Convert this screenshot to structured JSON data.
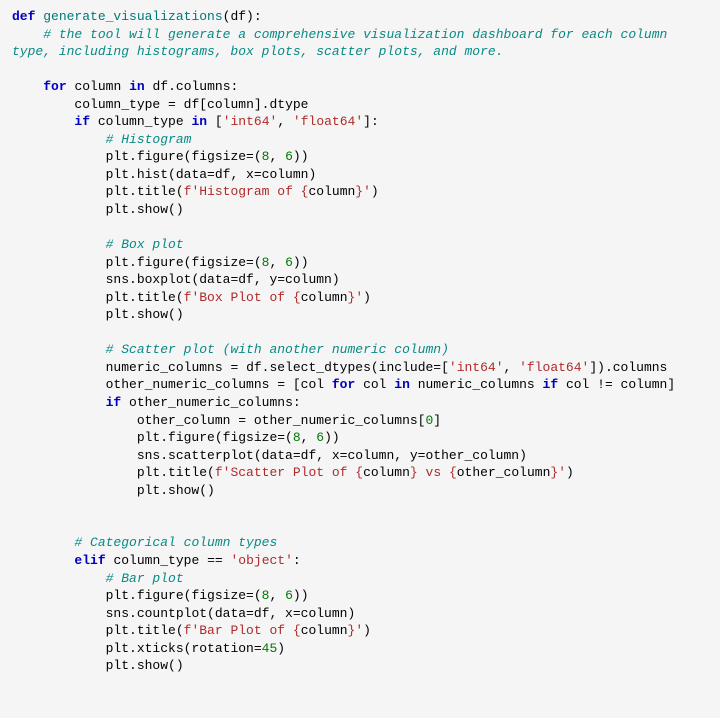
{
  "code": {
    "fn_def": "def",
    "fn_name": "generate_visualizations",
    "fn_args": "(df):",
    "comment_intro": "# the tool will generate a comprehensive visualization dashboard for each column type, including histograms, box plots, scatter plots, and more.",
    "for_kw": "for",
    "in_kw": "in",
    "if_kw": "if",
    "elif_kw": "elif",
    "loop_var": "column",
    "df_columns": "df.columns:",
    "column_type": "column_type",
    "assign": " = ",
    "df_col": "df[column].dtype",
    "type_check": "column_type",
    "int64": "'int64'",
    "float64": "'float64'",
    "object_str": "'object'",
    "hist_comment": "# Histogram",
    "box_comment": "# Box plot",
    "scatter_comment": "# Scatter plot (with another numeric column)",
    "categorical_comment": "# Categorical column types",
    "bar_comment": "# Bar plot",
    "plt_figure": "plt.figure(figsize=(",
    "figsize_w": "8",
    "figsize_h": "6",
    "plt_hist": "plt.hist(data=df, x=column)",
    "plt_title": "plt.title(",
    "plt_show": "plt.show()",
    "plt_xticks": "plt.xticks(rotation=",
    "rotation_val": "45",
    "f_prefix": "f",
    "hist_title_a": "'Histogram of ",
    "box_title_a": "'Box Plot of ",
    "scatter_title_a": "'Scatter Plot of ",
    "scatter_title_b": " vs ",
    "bar_title_a": "'Bar Plot of ",
    "brace_open": "{",
    "brace_close": "}",
    "col_var": "column",
    "other_col_var": "other_column",
    "title_end": "'",
    "sns_box": "sns.boxplot(data=df, y=column)",
    "sns_count": "sns.countplot(data=df, x=column)",
    "sns_scatter": "sns.scatterplot(data=df, x=column, y=other_column)",
    "numeric_cols": "numeric_columns",
    "select_dtypes": "df.select_dtypes(include=[",
    "dot_columns": "]).columns",
    "other_numeric_cols": "other_numeric_columns",
    "list_comp_a": "[col ",
    "list_comp_b": " col ",
    "list_comp_c": " numeric_columns ",
    "list_comp_d": " col != column]",
    "if_other": "other_numeric_columns:",
    "other_col_assign": "other_column = other_numeric_columns[",
    "zero": "0",
    "bracket_close": "]",
    "eq_check": " == "
  }
}
